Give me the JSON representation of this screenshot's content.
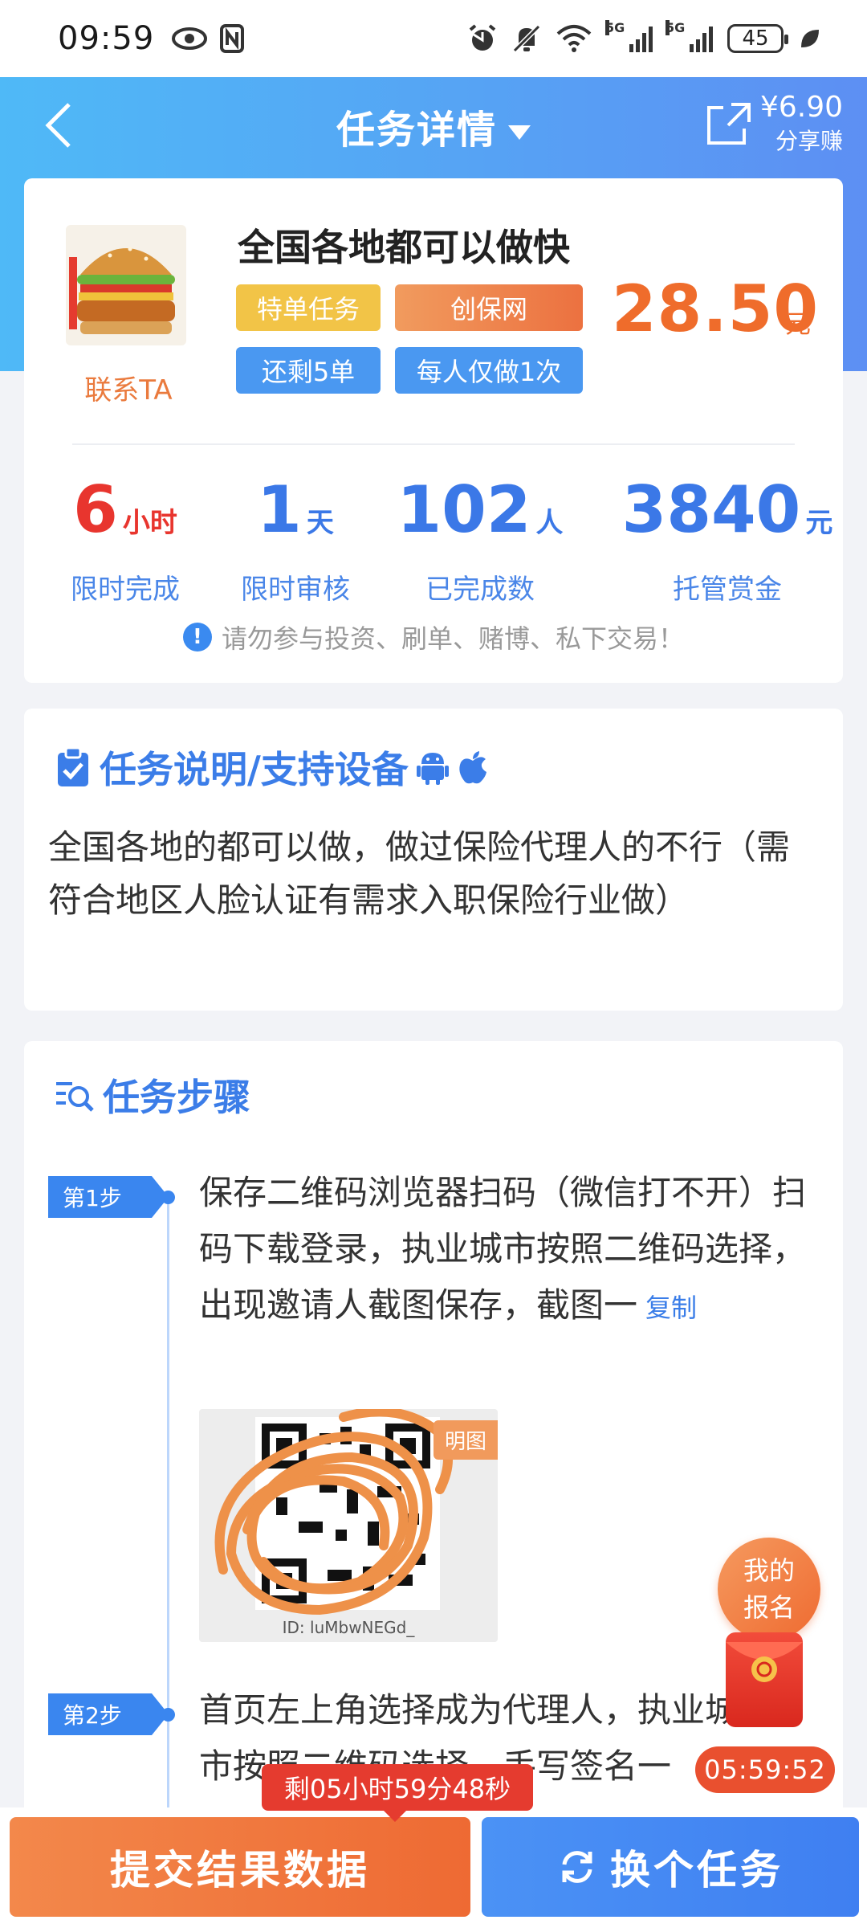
{
  "status_bar": {
    "time": "09:59",
    "network": "5G",
    "battery": "45"
  },
  "nav": {
    "title": "任务详情",
    "share_amount": "¥6.90",
    "share_label": "分享赚"
  },
  "task": {
    "contact_label": "联系TA",
    "title": "全国各地都可以做快",
    "tags": [
      "特单任务",
      "创保网",
      "还剩5单",
      "每人仅做1次"
    ],
    "price": "28.50",
    "price_unit": "元",
    "stats": [
      {
        "value": "6",
        "unit": "小时",
        "label": "限时完成",
        "color": "#e8352e"
      },
      {
        "value": "1",
        "unit": "天",
        "label": "限时审核",
        "color": "#3b78e7"
      },
      {
        "value": "102",
        "unit": "人",
        "label": "已完成数",
        "color": "#3b78e7"
      },
      {
        "value": "3840",
        "unit": "元",
        "label": "托管赏金",
        "color": "#3b78e7"
      }
    ],
    "warning": "请勿参与投资、刷单、赌博、私下交易！"
  },
  "description": {
    "title": "任务说明/支持设备",
    "text": "全国各地的都可以做，做过保险代理人的不行（需符合地区人脸认证有需求入职保险行业做）"
  },
  "steps": {
    "title": "任务步骤",
    "items": [
      {
        "badge": "第1步",
        "text": "保存二维码浏览器扫码（微信打不开）扫码下载登录，执业城市按照二维码选择，出现邀请人截图保存，截图一",
        "copy": "复制",
        "qr_tag": "明图",
        "qr_id": "ID: luMbwNEGd_"
      },
      {
        "badge": "第2步",
        "text": "首页左上角选择成为代理人，执业城市按照二维码选择，手写签名一"
      }
    ]
  },
  "floating": {
    "my_signup": [
      "我的",
      "报名"
    ],
    "countdown": "05:59:52"
  },
  "bottom": {
    "remaining": "剩05小时59分48秒",
    "submit": "提交结果数据",
    "switch": "换个任务"
  },
  "colors": {
    "accent_blue": "#3b78e7",
    "accent_orange": "#ef6c2b",
    "alert_red": "#e53b2f"
  }
}
